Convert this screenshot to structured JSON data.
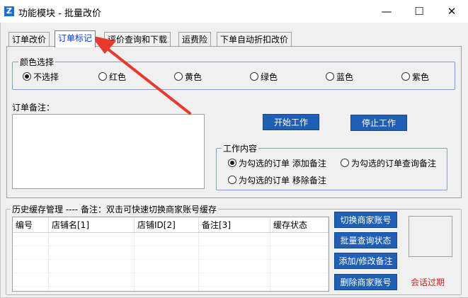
{
  "window": {
    "title": "功能模块 - 批量改价",
    "app_icon": "Z",
    "controls": {
      "minimize": "—",
      "maximize": "☐",
      "close": "✕"
    }
  },
  "tabs": [
    {
      "label": "订单改价",
      "active": false
    },
    {
      "label": "订单标记",
      "active": true
    },
    {
      "label": "评价查询和下载",
      "active": false
    },
    {
      "label": "运费险",
      "active": false
    },
    {
      "label": "下单自动折扣改价",
      "active": false
    }
  ],
  "color_group": {
    "legend": "颜色选择",
    "options": [
      {
        "label": "不选择",
        "checked": true
      },
      {
        "label": "红色",
        "checked": false
      },
      {
        "label": "黄色",
        "checked": false
      },
      {
        "label": "绿色",
        "checked": false
      },
      {
        "label": "蓝色",
        "checked": false
      },
      {
        "label": "紫色",
        "checked": false
      }
    ]
  },
  "memo": {
    "label": "订单备注：",
    "value": ""
  },
  "actions": {
    "start": "开始工作",
    "stop": "停止工作"
  },
  "work_group": {
    "legend": "工作内容",
    "options": [
      {
        "label": "为勾选的订单 添加备注",
        "checked": true
      },
      {
        "label": "为勾选的订单查询备注",
        "checked": false
      },
      {
        "label": "为勾选的订单 移除备注",
        "checked": false
      }
    ]
  },
  "history": {
    "legend": "历史缓存管理 ---- 备注：双击可快速切换商家账号缓存",
    "columns": [
      "编号",
      "店铺名[1]",
      "店铺ID[2]",
      "备注[3]",
      "缓存状态"
    ],
    "rows": []
  },
  "side_buttons": [
    "切换商家账号",
    "批量查询状态",
    "添加/修改备注",
    "删除商家账号"
  ],
  "session_status": "会话过期",
  "colors": {
    "accent_button": "#1f5fb4",
    "arrow": "#e8392f",
    "expired": "#d42020",
    "group_border": "#7aa0d6"
  }
}
